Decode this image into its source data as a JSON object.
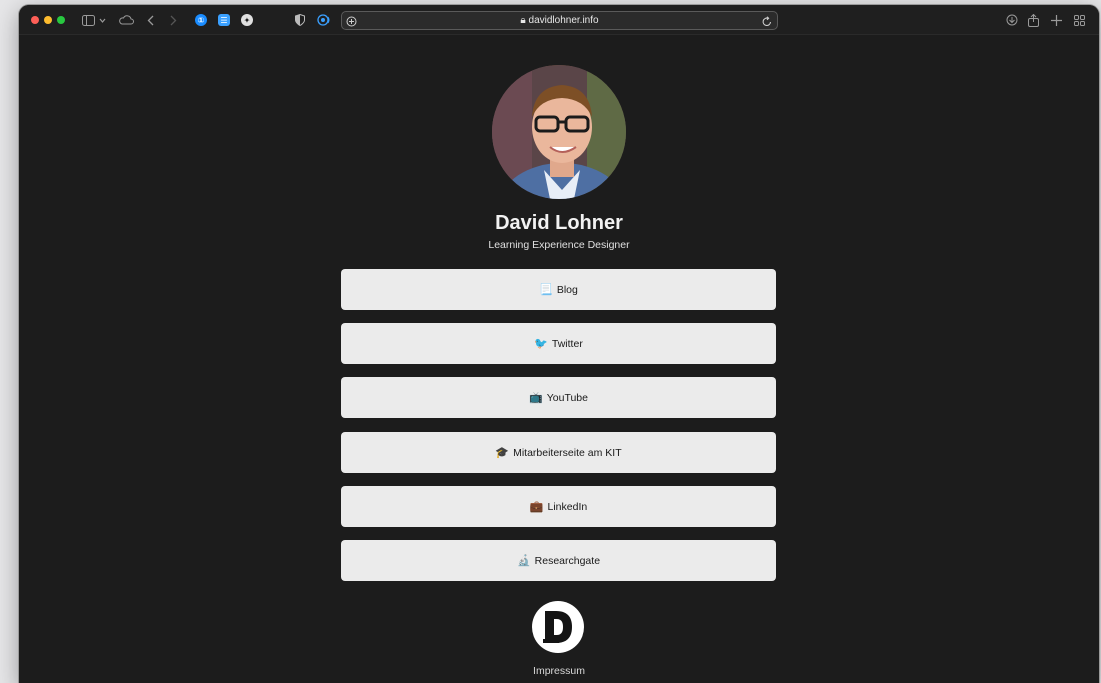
{
  "browser": {
    "url": "davidlohner.info",
    "icons": [
      "sidebar-icon",
      "chevron-down-icon",
      "cloud-icon",
      "back-icon",
      "forward-icon",
      "1password-icon",
      "extension-icon",
      "privacy-icon",
      "shield-icon",
      "tracker-icon",
      "reader-icon",
      "reload-icon",
      "download-icon",
      "share-icon",
      "new-tab-icon",
      "tab-overview-icon"
    ]
  },
  "profile": {
    "name": "David Lohner",
    "subtitle": "Learning Experience Designer"
  },
  "links": [
    {
      "emoji": "📃",
      "label": "Blog"
    },
    {
      "emoji": "🐦",
      "label": "Twitter"
    },
    {
      "emoji": "📺",
      "label": "YouTube"
    },
    {
      "emoji": "🎓",
      "label": "Mitarbeiterseite am KIT"
    },
    {
      "emoji": "💼",
      "label": "LinkedIn"
    },
    {
      "emoji": "🔬",
      "label": "Researchgate"
    }
  ],
  "footer": {
    "logo_letter": "D",
    "impressum": "Impressum"
  },
  "colors": {
    "page_background": "#1c1c1c",
    "button_background": "#ebebeb",
    "accent": "#3aa0ff"
  }
}
